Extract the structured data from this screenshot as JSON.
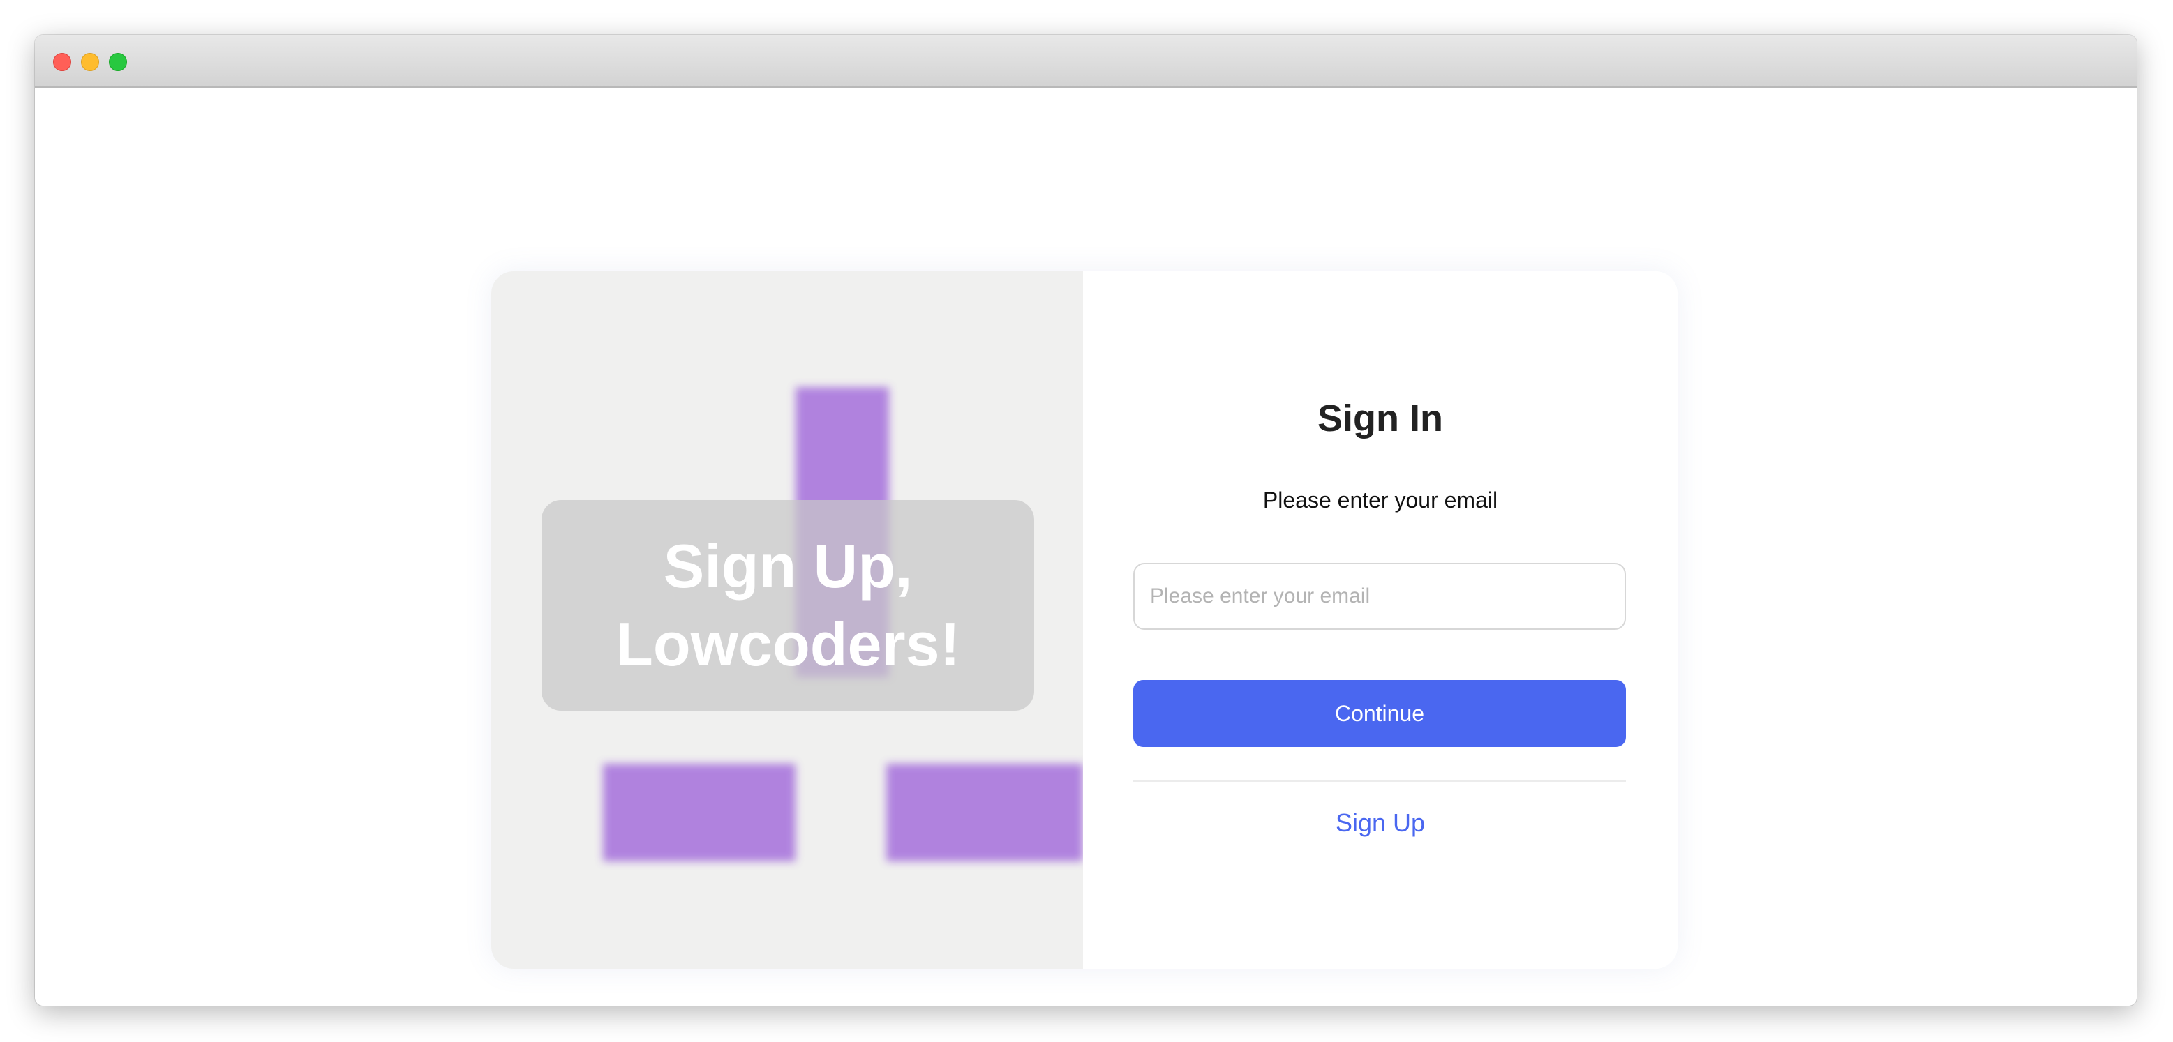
{
  "window": {
    "controls": [
      "close",
      "minimize",
      "maximize"
    ]
  },
  "hero": {
    "text": "Sign Up,\nLowcoders!"
  },
  "signin": {
    "title": "Sign In",
    "subtitle": "Please enter your email",
    "email_placeholder": "Please enter your email",
    "email_value": "",
    "continue_label": "Continue",
    "signup_label": "Sign Up"
  },
  "colors": {
    "accent": "#4a67f0",
    "hero_bars": "#a56fdc",
    "left_panel_bg": "#f0f0ef"
  }
}
